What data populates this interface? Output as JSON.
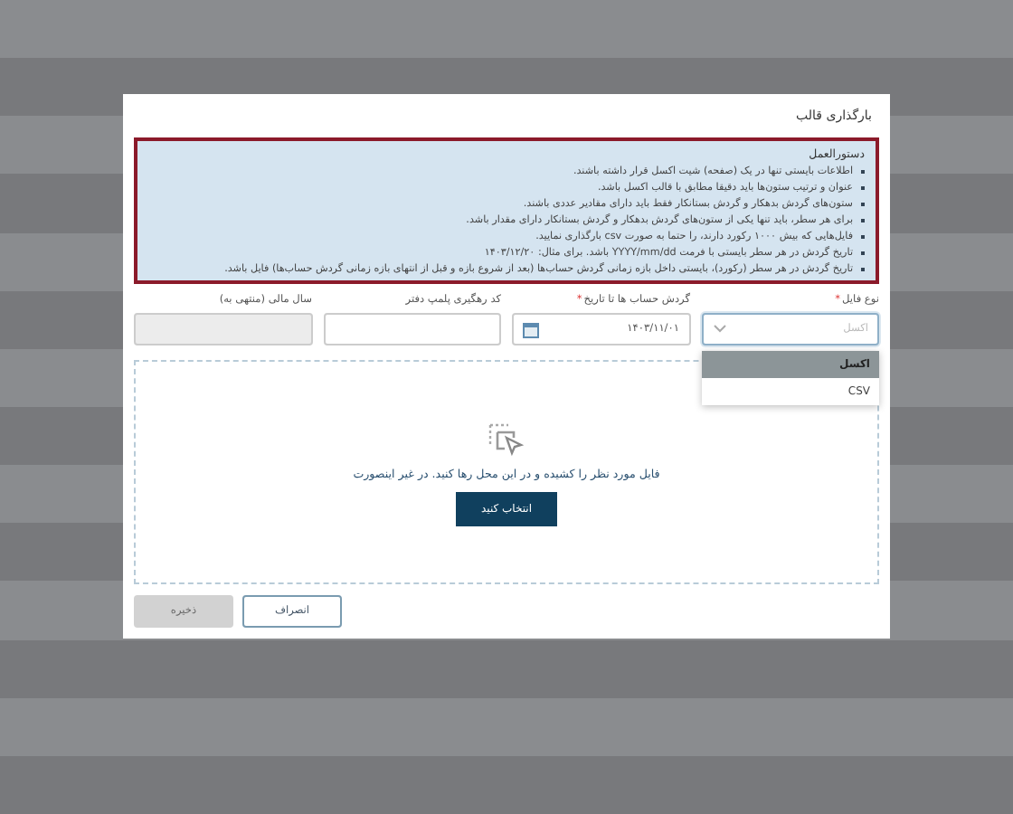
{
  "dialog": {
    "title": "بارگذاری قالب",
    "instructions": {
      "heading": "دستورالعمل",
      "items": [
        "اطلاعات بایستی تنها در یک (صفحه) شیت اکسل قرار داشته باشند.",
        "عنوان و ترتیب ستون‌ها باید دقیقا مطابق با قالب اکسل باشد.",
        "ستون‌های گردش بدهکار و گردش بستانکار فقط باید دارای مقادیر عددی باشند.",
        "برای هر سطر، باید تنها یکی از ستون‌های گردش بدهکار و گردش بستانکار دارای مقدار باشد.",
        "فایل‌هایی که بیش ۱۰۰۰ رکورد دارند، را حتما به صورت csv بارگذاری نمایید.",
        "تاریخ گردش در هر سطر بایستی با فرمت YYYY/mm/dd باشد. برای مثال: ۱۴۰۳/۱۲/۲۰",
        "تاریخ گردش در هر سطر (رکورد)، بایستی داخل بازه زمانی گردش حساب‌ها (بعد از شروع بازه و قبل از انتهای بازه زمانی گردش حساب‌ها) فایل باشد."
      ]
    },
    "fields": [
      {
        "kind": "select",
        "label": "نوع فایل",
        "marker": "*",
        "placeholder": "اکسل",
        "disabled": false,
        "expanded": true,
        "options": [
          {
            "label": "اکسل",
            "selected": true
          },
          {
            "label": "CSV",
            "selected": false
          }
        ]
      },
      {
        "kind": "date",
        "label": "گردش حساب ها تا تاریخ",
        "marker": "*",
        "value": "۱۴۰۳/۱۱/۰۱",
        "disabled": false
      },
      {
        "kind": "text",
        "label": "کد رهگیری پلمپ دفتر",
        "disabled": false
      },
      {
        "kind": "text",
        "label": "سال مالی (منتهی به)",
        "disabled": true
      }
    ],
    "dropzone": {
      "text": "فایل مورد نظر را کشیده و در این محل رها کنید. در غیر اینصورت",
      "button": "انتخاب کنید"
    },
    "buttons": [
      {
        "label": "انصراف",
        "kind": "secondary",
        "disabled": false
      },
      {
        "label": "ذخیره",
        "kind": "primary",
        "disabled": true
      }
    ]
  }
}
